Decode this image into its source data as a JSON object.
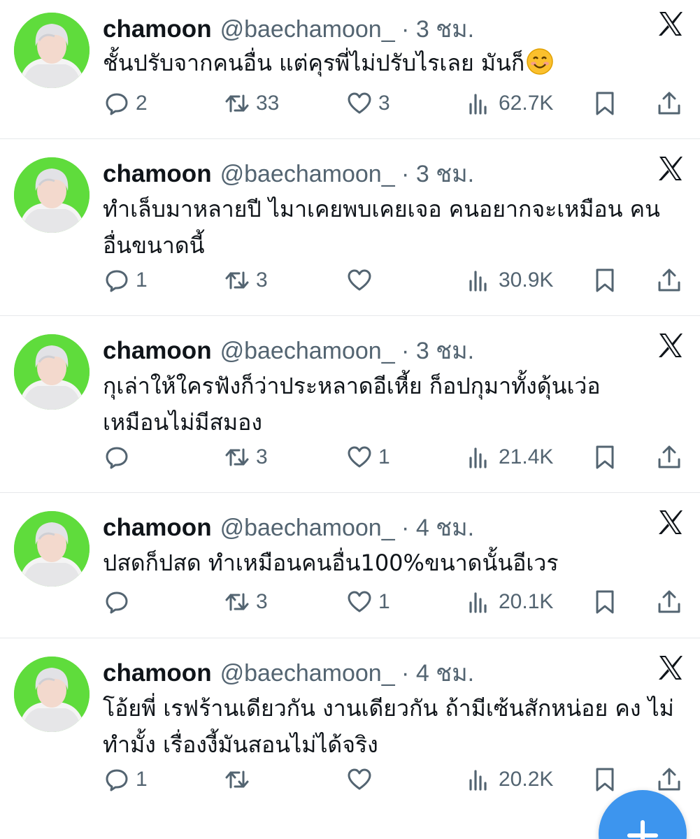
{
  "tweets": [
    {
      "name": "chamoon",
      "meta": "@baechamoon_ · 3 ชม.",
      "text": "ชั้นปรับจากคนอื่น แต่คุรพี่ไม่ปรับไรเลย มันก็",
      "replies": "2",
      "retweets": "33",
      "likes": "3",
      "views": "62.7K"
    },
    {
      "name": "chamoon",
      "meta": "@baechamoon_ · 3 ชม.",
      "text": "ทำเล็บมาหลายปี ไมาเคยพบเคยเจอ คนอยากจะเหมือน คนอื่นขนาดนี้",
      "replies": "1",
      "retweets": "3",
      "likes": "",
      "views": "30.9K"
    },
    {
      "name": "chamoon",
      "meta": "@baechamoon_ · 3 ชม.",
      "text": "กุเล่าให้ใครฟังก็ว่าประหลาดอีเหี้ย ก็อปกุมาทั้งดุ้นเว่อ เหมือนไม่มีสมอง",
      "replies": "",
      "retweets": "3",
      "likes": "1",
      "views": "21.4K"
    },
    {
      "name": "chamoon",
      "meta": "@baechamoon_ · 4 ชม.",
      "text": "ปสดก็ปสด ทำเหมือนคนอื่น100%ขนาดนั้นอีเวร",
      "replies": "",
      "retweets": "3",
      "likes": "1",
      "views": "20.1K"
    },
    {
      "name": "chamoon",
      "meta": "@baechamoon_ · 4 ชม.",
      "text": "โอ้ยพี่ เรฟร้านเดียวกัน งานเดียวกัน ถ้ามีเซ้นสักหน่อย คง ไม่ทำมั้ง เรื่องงี้มันสอนไม่ได้จริง",
      "replies": "1",
      "retweets": "",
      "likes": "",
      "views": "20.2K"
    }
  ],
  "icons": {
    "reply": "reply-icon",
    "retweet": "retweet-icon",
    "like": "heart-icon",
    "views": "views-icon",
    "bookmark": "bookmark-icon",
    "share": "share-icon",
    "platform": "x-logo-icon",
    "compose": "plus-icon",
    "emoji": "smiling-face-emoji"
  },
  "colors": {
    "accent": "#3d95ee",
    "avatar_bg": "#5fdc3c",
    "secondary_text": "#536471",
    "divider": "#e6e8eb"
  }
}
